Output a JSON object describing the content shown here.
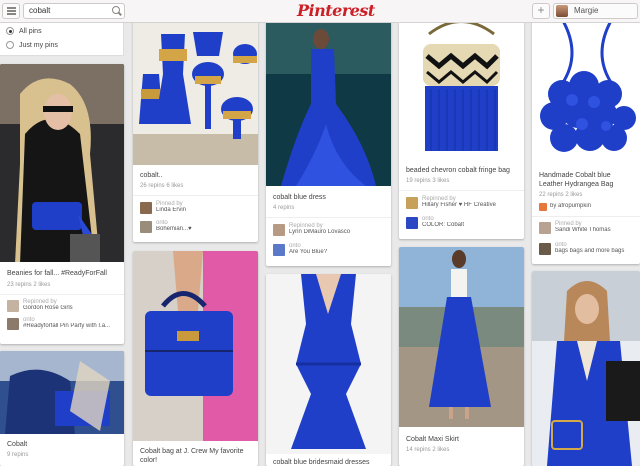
{
  "header": {
    "search_value": "cobalt",
    "logo": "Pinterest",
    "add_label": "+",
    "user_name": "Margie"
  },
  "filter": {
    "options": [
      {
        "label": "All pins",
        "selected": true
      },
      {
        "label": "Just my pins",
        "selected": false
      }
    ]
  },
  "colors": {
    "brand": "#cb2027",
    "cobalt": "#1f3fc9"
  },
  "pins": [
    {
      "title": "Beanies for fall... #ReadyForFall",
      "stats": "23 repins    2 likes",
      "line1_label": "Repinned by",
      "line1_value": "Gordon Rose Girls",
      "line2_label": "onto",
      "line2_value": "#Readyforfall Pin Party with I.a..."
    },
    {
      "title": "Cobalt",
      "stats": "9 repins"
    },
    {
      "title": "cobalt..",
      "stats": "26 repins    6 likes",
      "line1_label": "Pinned by",
      "line1_value": "Linda Ervin",
      "line2_label": "onto",
      "line2_value": "Bohemian...♥"
    },
    {
      "title": "Cobalt bag at J. Crew My favorite color!"
    },
    {
      "title": "cobalt blue dress",
      "stats": "4 repins",
      "line1_label": "Repinned by",
      "line1_value": "Lynn DiMauro Lovasco",
      "line2_label": "onto",
      "line2_value": "Are You Blue?"
    },
    {
      "title": "cobalt blue bridesmaid dresses"
    },
    {
      "title": "beaded chevron cobalt fringe bag",
      "stats": "19 repins    3 likes",
      "line1_label": "Repinned by",
      "line1_value": "Hillary Fisher ♥ HF Creative",
      "line2_label": "onto",
      "line2_value": "COLOR: Cobalt"
    },
    {
      "title": "Cobalt Maxi Skirt",
      "stats": "14 repins    2 likes"
    },
    {
      "title": "Handmade Cobalt blue Leather Hydrangea Bag",
      "stats": "22 repins    2 likes",
      "line1_label": "",
      "line1_value": "by afropumpkin",
      "line2_label": "Pinned by",
      "line2_value": "Sandi White Thomas",
      "line3_label": "onto",
      "line3_value": "bags bags and more bags"
    }
  ]
}
